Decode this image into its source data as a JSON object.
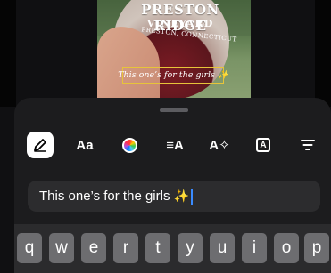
{
  "photo": {
    "logo_title": "PRESTON RIDGE",
    "logo_sub": "VINEYARD",
    "logo_place": "PRESTON, CONNECTICUT"
  },
  "caption_overlay": "This one’s for the girls ✨",
  "toolbar": [
    {
      "name": "draw-tool",
      "icon": "pen-icon",
      "active": true
    },
    {
      "name": "font-tool",
      "label": "Aa"
    },
    {
      "name": "color-tool",
      "icon": "color-wheel-icon"
    },
    {
      "name": "align-tool",
      "label": "≡A"
    },
    {
      "name": "effects-tool",
      "label": "A✧"
    },
    {
      "name": "background-tool",
      "label": "A"
    },
    {
      "name": "alignment-menu-tool",
      "icon": "lines-icon"
    }
  ],
  "input": {
    "text": "This one’s for the girls",
    "emoji": "✨"
  },
  "keyboard": {
    "row1": [
      "q",
      "w",
      "e",
      "r",
      "t",
      "y",
      "u",
      "i",
      "o",
      "p"
    ]
  },
  "colors": {
    "sheet": "#1c1c1e",
    "field": "#2c2c2e",
    "key": "#6d6d70",
    "caption_border": "#e7c43a",
    "cursor": "#3a8bff"
  }
}
